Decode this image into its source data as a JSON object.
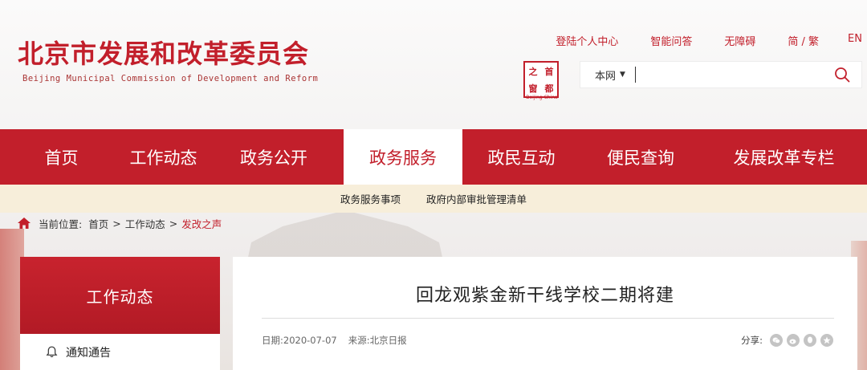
{
  "header": {
    "logo_cn": "北京市发展和改革委员会",
    "logo_en": "Beijing Municipal Commission of Development and Reform",
    "top_links": [
      {
        "label": "登陆个人中心"
      },
      {
        "label": "智能问答"
      },
      {
        "label": "无障碍"
      },
      {
        "label": "简 / 繁"
      },
      {
        "label": "EN"
      }
    ],
    "seal": {
      "chars": [
        "之",
        "首",
        "窗",
        "都"
      ],
      "sub": "Beijing·China"
    },
    "search": {
      "scope": "本网",
      "placeholder": "",
      "value": "",
      "icon": "search-icon"
    }
  },
  "nav": {
    "items": [
      {
        "label": "首页"
      },
      {
        "label": "工作动态"
      },
      {
        "label": "政务公开"
      },
      {
        "label": "政务服务",
        "active": true
      },
      {
        "label": "政民互动"
      },
      {
        "label": "便民查询"
      },
      {
        "label": "发展改革专栏"
      }
    ]
  },
  "subnav": {
    "items": [
      "政务服务事项",
      "政府内部审批管理清单"
    ]
  },
  "breadcrumb": {
    "prefix": "当前位置:",
    "items": [
      "首页",
      "工作动态",
      "发改之声"
    ],
    "separator": ">"
  },
  "sidebar": {
    "title": "工作动态",
    "items": [
      {
        "label": "通知通告",
        "icon": "bell-icon"
      }
    ]
  },
  "article": {
    "title": "回龙观紫金新干线学校二期将建",
    "date": "日期:2020-07-07",
    "source": "来源:北京日报",
    "share_label": "分享:",
    "share_icons": [
      "wechat-icon",
      "weibo-icon",
      "qq-icon",
      "qzone-icon"
    ]
  },
  "colors": {
    "brand_red": "#c21f2b",
    "subnav_bg": "#f7eeda"
  }
}
